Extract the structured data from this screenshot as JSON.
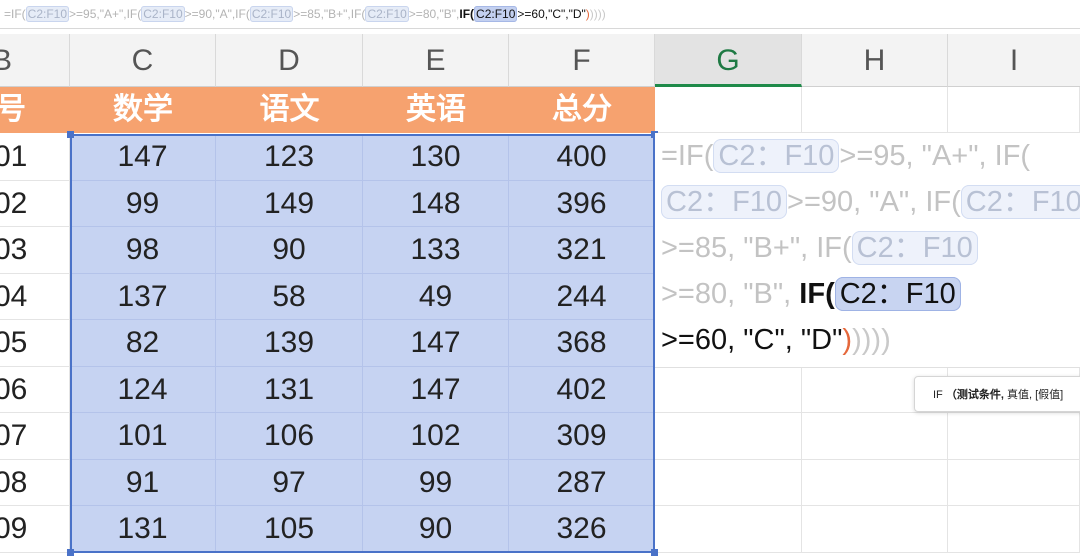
{
  "formula_bar": {
    "prefix": "=IF(",
    "r1": "C2:F10",
    "t1": ">=95,\"A+\",IF(",
    "r2": "C2:F10",
    "t2": ">=90,\"A\",IF(",
    "r3": "C2:F10",
    "t3": ">=85,\"B+\",IF(",
    "r4": "C2:F10",
    "t4": ">=80,\"B\",",
    "cur_if": "IF(",
    "cur_ref": "C2:F10",
    "cur_rest": ">=60,\"C\",\"D\"",
    "close_active": ")",
    "close_faded": "))))"
  },
  "column_headers": [
    "B",
    "C",
    "D",
    "E",
    "F",
    "G",
    "H",
    "I"
  ],
  "active_column": "G",
  "header_row": [
    "号",
    "数学",
    "语文",
    "英语",
    "总分"
  ],
  "rows": [
    {
      "id": "01",
      "values": [
        "147",
        "123",
        "130",
        "400"
      ]
    },
    {
      "id": "02",
      "values": [
        "99",
        "149",
        "148",
        "396"
      ]
    },
    {
      "id": "03",
      "values": [
        "98",
        "90",
        "133",
        "321"
      ]
    },
    {
      "id": "04",
      "values": [
        "137",
        "58",
        "49",
        "244"
      ]
    },
    {
      "id": "05",
      "values": [
        "82",
        "139",
        "147",
        "368"
      ]
    },
    {
      "id": "06",
      "values": [
        "124",
        "131",
        "147",
        "402"
      ]
    },
    {
      "id": "07",
      "values": [
        "101",
        "106",
        "102",
        "309"
      ]
    },
    {
      "id": "08",
      "values": [
        "91",
        "97",
        "99",
        "287"
      ]
    },
    {
      "id": "09",
      "values": [
        "131",
        "105",
        "90",
        "326"
      ]
    }
  ],
  "editor": {
    "l1a": "=IF(",
    "l1ref": "C2：F10",
    "l1b": ">=95, \"A+\", IF(",
    "l2ref": "C2：F10",
    "l2a": ">=90, \"A\", IF(",
    "l2ref2": "C2：F10",
    "l3a": ">=85, \"B+\", IF(",
    "l3ref": "C2：F10",
    "l4a": ">=80, \"B\", ",
    "l4if": "IF(",
    "l4ref": "C2：F10",
    "l5a": ">=60, \"C\", \"D\"",
    "l5close": ")",
    "l5faded": "))))"
  },
  "tooltip": {
    "fn": "IF",
    "args_bold": "（测试条件,",
    "args_rest": " 真值, [假值]"
  },
  "colors": {
    "header_band": "#f6a26f",
    "selection": "#c6d3f2",
    "active_column_text": "#1f7a44"
  }
}
